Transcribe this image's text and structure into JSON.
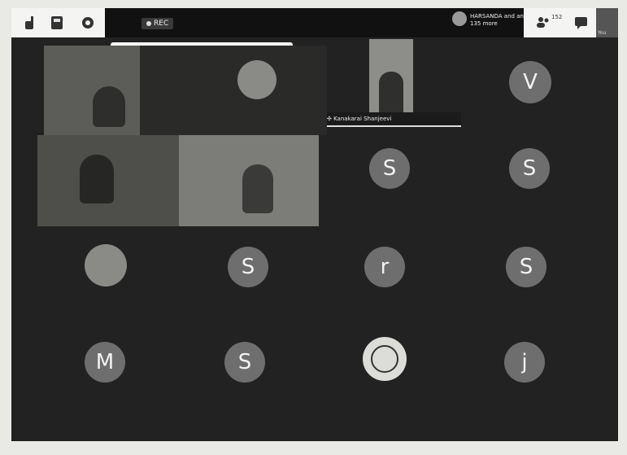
{
  "toolbar": {
    "rec_label": "REC",
    "speaker_text": "HARSANDA and and 135 more",
    "people_count": "152",
    "self_label": "You"
  },
  "tiles": {
    "pinned_name": "Kanakarai Shanjeevi",
    "avatars": [
      "V",
      "S",
      "S",
      "S",
      "r",
      "S",
      "M",
      "S",
      "j"
    ]
  },
  "colors": {
    "background": "#222222",
    "avatar": "#6e6e6e",
    "topbar": "#f4f4f2"
  }
}
